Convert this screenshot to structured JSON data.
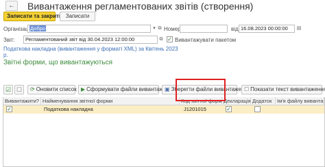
{
  "window": {
    "back_icon": "arrow-left-icon",
    "title": "Вивантаження регламентованих звітів (створення)"
  },
  "toolbar_main": {
    "save_close_label": "Записати та закрити",
    "write_label": "Записати"
  },
  "form": {
    "organization_label": "Організація:",
    "organization_value": "Добро",
    "number_label": "Номер:",
    "number_value": "",
    "date_label": "від:",
    "date_value": "16.08.2023 00:00:00",
    "report_label": "Звіт:",
    "report_value": "Регламентований звіт від 30.04.2023 12:00:00",
    "batch_label": "Вивантажувати пакетом",
    "batch_checked": true
  },
  "link": {
    "line1": "Податкова накладна (вивантаження у форматі XML) за Квітень 2023",
    "line2": "р."
  },
  "section_title": "Звітні форми, що вивантажуються",
  "list_toolbar": {
    "refresh_label": "Оновити список",
    "generate_label": "Сформувати файли вивантаження",
    "save_label": "Зберегти файли вивантаження",
    "show_text_label": "Показати текст вивантаження"
  },
  "table": {
    "columns": [
      "Вивантажити?",
      "Найменування звітної форми",
      "Код звітної форми",
      "Декларація",
      "Додаток",
      "Ім'я файлу вивантаження"
    ],
    "rows": [
      {
        "export": true,
        "name": "Податкова накладна",
        "code": "J1201015",
        "declaration": true,
        "appendix": false,
        "file_name": ""
      }
    ]
  },
  "colors": {
    "primary_button": "#f5d235",
    "section_title": "#3d8c3d",
    "link": "#3b6fb6",
    "highlight_box": "#e02020",
    "selected_row": "#fbeec4"
  }
}
